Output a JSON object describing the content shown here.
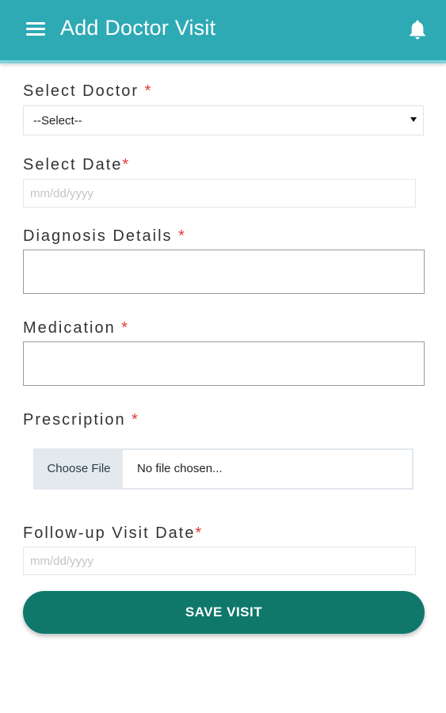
{
  "app_bar": {
    "title": "Add Doctor Visit",
    "menu_icon": "hamburger-menu-icon",
    "notification_icon": "bell-icon",
    "color": "#2eaab4"
  },
  "form": {
    "required_marker": "*",
    "doctor": {
      "label": "Select Doctor",
      "selected": "--Select--"
    },
    "visit_date": {
      "label": "Select Date",
      "placeholder": "mm/dd/yyyy"
    },
    "diagnosis": {
      "label": "Diagnosis Details",
      "value": ""
    },
    "medication": {
      "label": "Medication",
      "value": ""
    },
    "prescription": {
      "label": "Prescription",
      "button_label": "Choose File",
      "file_status": "No file chosen..."
    },
    "follow_up": {
      "label": "Follow-up Visit Date",
      "placeholder": "mm/dd/yyyy"
    },
    "submit_label": "SAVE VISIT",
    "submit_color": "#0f786a",
    "required_color": "#e53935"
  }
}
